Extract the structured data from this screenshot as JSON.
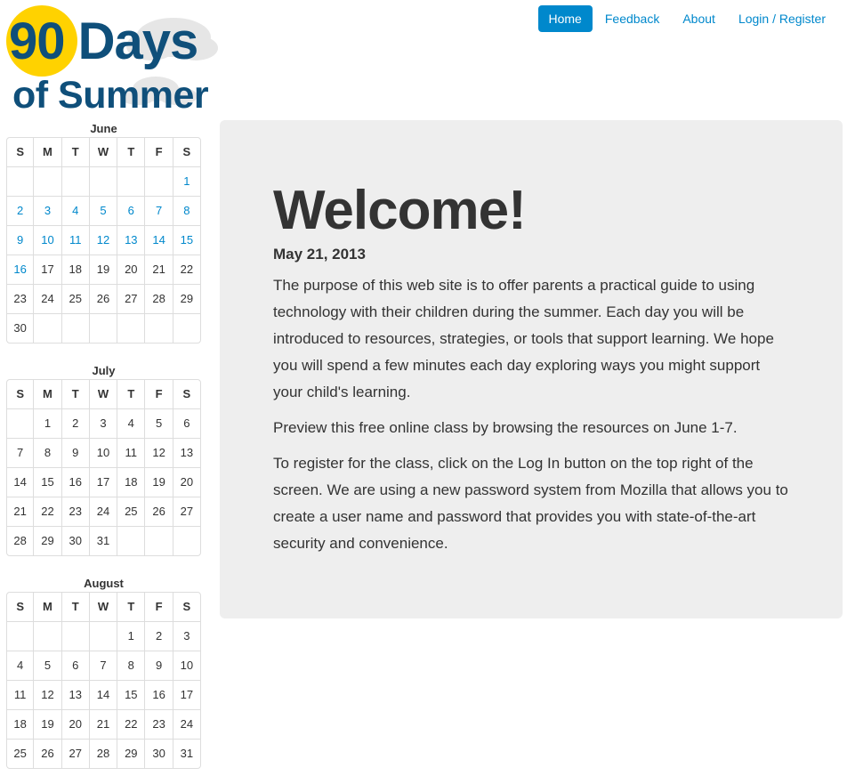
{
  "logo": {
    "line1": "90 Days",
    "line2": "of Summer"
  },
  "nav": {
    "items": [
      "Home",
      "Feedback",
      "About",
      "Login / Register"
    ],
    "active": "Home"
  },
  "calendars": [
    {
      "month": "June",
      "headers": [
        "S",
        "M",
        "T",
        "W",
        "T",
        "F",
        "S"
      ],
      "weeks": [
        [
          "",
          "",
          "",
          "",
          "",
          "",
          "1"
        ],
        [
          "2",
          "3",
          "4",
          "5",
          "6",
          "7",
          "8"
        ],
        [
          "9",
          "10",
          "11",
          "12",
          "13",
          "14",
          "15"
        ],
        [
          "16",
          "17",
          "18",
          "19",
          "20",
          "21",
          "22"
        ],
        [
          "23",
          "24",
          "25",
          "26",
          "27",
          "28",
          "29"
        ],
        [
          "30",
          "",
          "",
          "",
          "",
          "",
          ""
        ]
      ],
      "linked_days": [
        "1",
        "2",
        "3",
        "4",
        "5",
        "6",
        "7",
        "8",
        "9",
        "10",
        "11",
        "12",
        "13",
        "14",
        "15",
        "16"
      ]
    },
    {
      "month": "July",
      "headers": [
        "S",
        "M",
        "T",
        "W",
        "T",
        "F",
        "S"
      ],
      "weeks": [
        [
          "",
          "1",
          "2",
          "3",
          "4",
          "5",
          "6"
        ],
        [
          "7",
          "8",
          "9",
          "10",
          "11",
          "12",
          "13"
        ],
        [
          "14",
          "15",
          "16",
          "17",
          "18",
          "19",
          "20"
        ],
        [
          "21",
          "22",
          "23",
          "24",
          "25",
          "26",
          "27"
        ],
        [
          "28",
          "29",
          "30",
          "31",
          "",
          "",
          ""
        ]
      ],
      "linked_days": []
    },
    {
      "month": "August",
      "headers": [
        "S",
        "M",
        "T",
        "W",
        "T",
        "F",
        "S"
      ],
      "weeks": [
        [
          "",
          "",
          "",
          "",
          "1",
          "2",
          "3"
        ],
        [
          "4",
          "5",
          "6",
          "7",
          "8",
          "9",
          "10"
        ],
        [
          "11",
          "12",
          "13",
          "14",
          "15",
          "16",
          "17"
        ],
        [
          "18",
          "19",
          "20",
          "21",
          "22",
          "23",
          "24"
        ],
        [
          "25",
          "26",
          "27",
          "28",
          "29",
          "30",
          "31"
        ]
      ],
      "linked_days": []
    }
  ],
  "hero": {
    "title": "Welcome!",
    "date": "May 21, 2013",
    "paragraphs": [
      "The purpose of this web site is to offer parents a practical guide to using technology with their children during the summer. Each day you will be introduced to resources, strategies, or tools that support learning. We hope you will spend a few minutes each day exploring ways you might support your child's learning.",
      "Preview this free online class by browsing the resources on June 1-7.",
      "To register for the class, click on the Log In button on the top right of the screen. We are using a new password system from Mozilla that allows you to create a user name and password that provides you with state-of-the-art security and convenience."
    ]
  },
  "colors": {
    "link": "#0088cc",
    "logo_blue": "#0f4f7a",
    "logo_yellow": "#ffd200",
    "hero_bg": "#eeeeee"
  }
}
